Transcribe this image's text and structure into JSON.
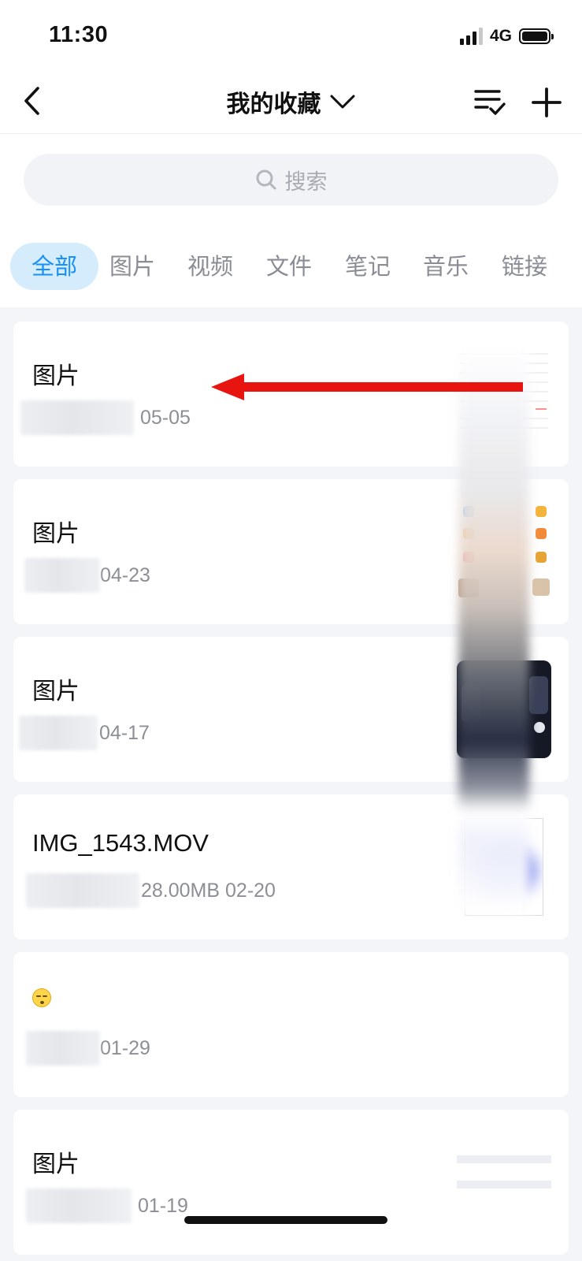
{
  "status_bar": {
    "time": "11:30",
    "network": "4G",
    "signal_bars": 3,
    "battery_level": 1.0
  },
  "nav": {
    "title": "我的收藏",
    "back_icon": "chevron-left-icon",
    "title_dropdown_icon": "chevron-down-icon",
    "sort_icon": "list-check-icon",
    "add_icon": "plus-icon"
  },
  "search": {
    "placeholder": "搜索",
    "icon": "search-icon"
  },
  "tabs": [
    {
      "label": "全部",
      "active": true
    },
    {
      "label": "图片",
      "active": false
    },
    {
      "label": "视频",
      "active": false
    },
    {
      "label": "文件",
      "active": false
    },
    {
      "label": "笔记",
      "active": false
    },
    {
      "label": "音乐",
      "active": false
    },
    {
      "label": "链接",
      "active": false
    }
  ],
  "items": [
    {
      "title": "图片",
      "meta": "05-05",
      "thumb": "screenshot-thumbnail"
    },
    {
      "title": "图片",
      "meta": "04-23",
      "thumb": "app-grid-thumbnail"
    },
    {
      "title": "图片",
      "meta": "04-17",
      "thumb": "dark-photo-thumbnail"
    },
    {
      "title": "IMG_1543.MOV",
      "meta": "28.00MB 02-20",
      "thumb": "video-thumbnail"
    },
    {
      "title": "",
      "meta": "01-29",
      "thumb": "none",
      "emoji": "sleepy-face-emoji"
    },
    {
      "title": "图片",
      "meta": "01-19",
      "thumb": "document-thumbnail"
    }
  ],
  "annotation": {
    "color": "#e8140f",
    "direction": "left"
  },
  "colors": {
    "accent": "#1a8ff5",
    "tab_active_bg": "#d4ecfc",
    "page_bg": "#f4f5f9",
    "card_bg": "#ffffff",
    "secondary_text": "#8c8f96"
  }
}
